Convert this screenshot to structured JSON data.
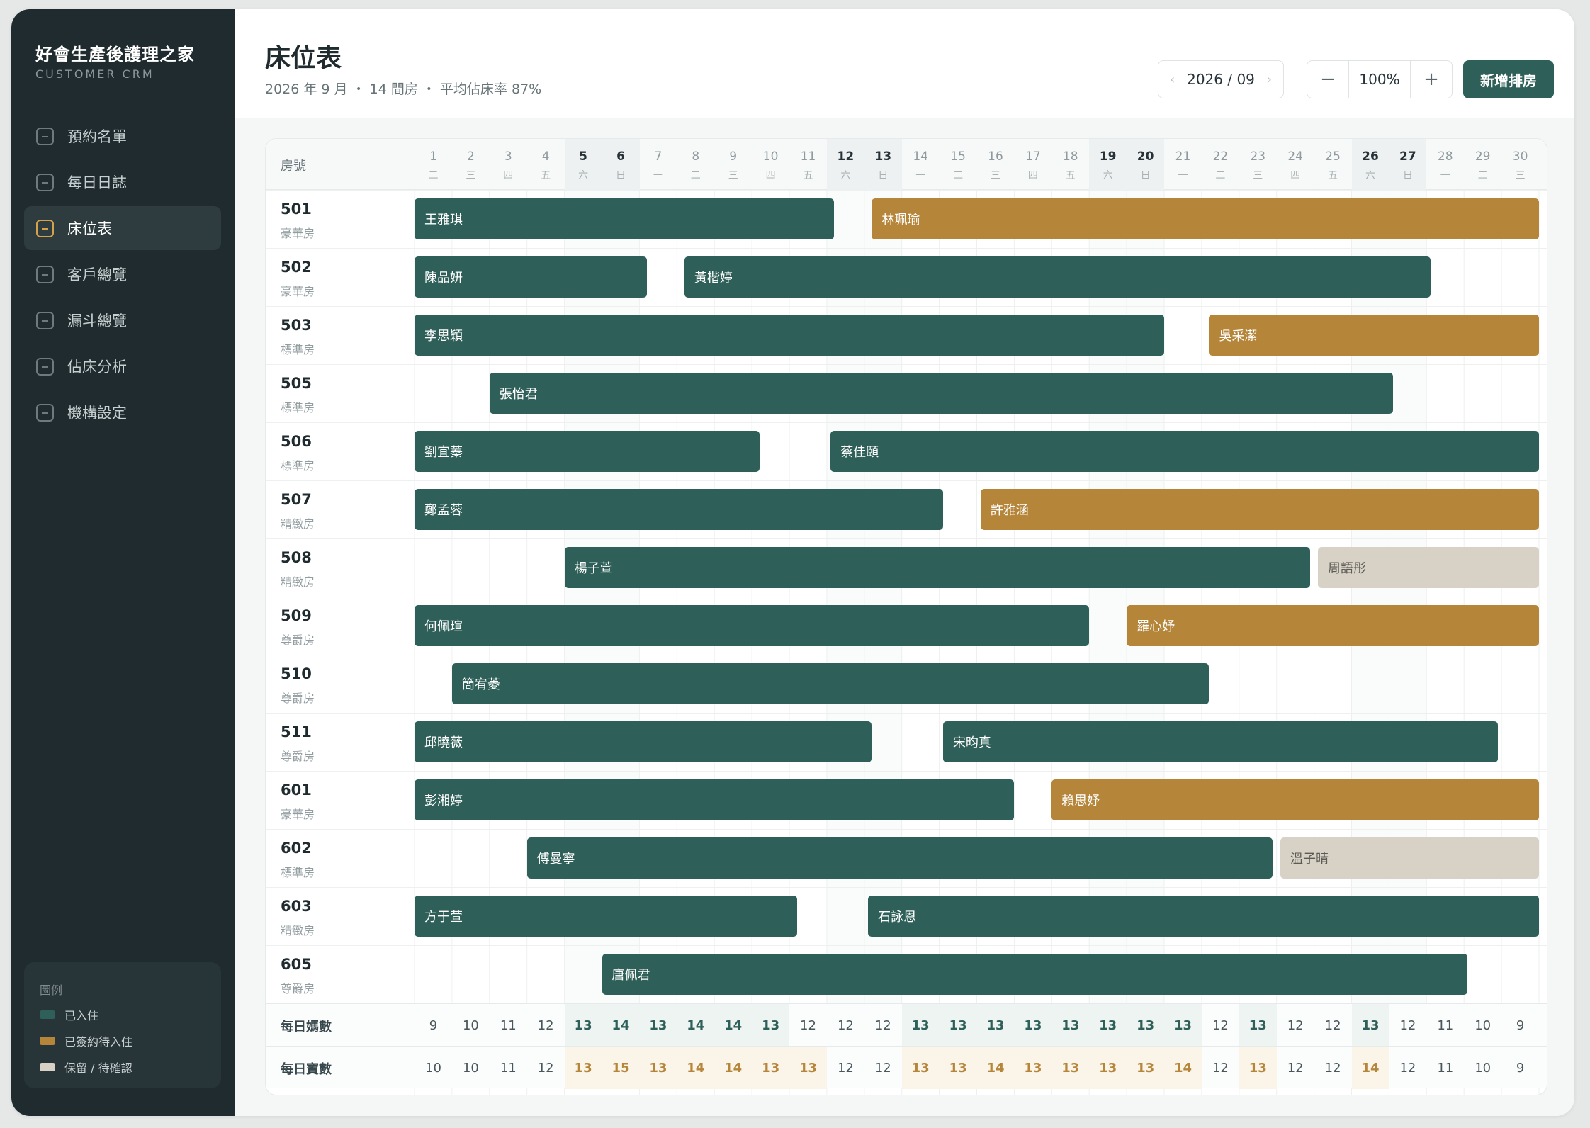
{
  "sidebar": {
    "brand": "好會生產後護理之家",
    "brand_sub": "CUSTOMER CRM",
    "nav": [
      "預約名單",
      "每日日誌",
      "床位表",
      "客戶總覽",
      "漏斗總覽",
      "佔床分析",
      "機構設定"
    ],
    "active_index": 2,
    "legend": {
      "title": "圖例",
      "items": [
        {
          "label": "已入住",
          "color": "#2e5f58"
        },
        {
          "label": "已簽約待入住",
          "color": "#b5853a"
        },
        {
          "label": "保留 / 待確認",
          "color": "#d8d2c6"
        }
      ]
    }
  },
  "header": {
    "title": "床位表",
    "subtitle": "2026 年 9 月 ・ 14 間房 ・ 平均佔床率 87%",
    "month": "2026 / 09",
    "zoom": "100%",
    "add_button": "新增排房",
    "prev_icon": "chevron-left-icon",
    "next_icon": "chevron-right-icon"
  },
  "grid": {
    "room_col_label": "房號",
    "days": [
      {
        "d": "1",
        "w": "二"
      },
      {
        "d": "2",
        "w": "三"
      },
      {
        "d": "3",
        "w": "四"
      },
      {
        "d": "4",
        "w": "五"
      },
      {
        "d": "5",
        "w": "六",
        "we": true
      },
      {
        "d": "6",
        "w": "日",
        "we": true
      },
      {
        "d": "7",
        "w": "一"
      },
      {
        "d": "8",
        "w": "二"
      },
      {
        "d": "9",
        "w": "三"
      },
      {
        "d": "10",
        "w": "四"
      },
      {
        "d": "11",
        "w": "五"
      },
      {
        "d": "12",
        "w": "六",
        "we": true
      },
      {
        "d": "13",
        "w": "日",
        "we": true
      },
      {
        "d": "14",
        "w": "一"
      },
      {
        "d": "15",
        "w": "二"
      },
      {
        "d": "16",
        "w": "三"
      },
      {
        "d": "17",
        "w": "四"
      },
      {
        "d": "18",
        "w": "五"
      },
      {
        "d": "19",
        "w": "六",
        "we": true
      },
      {
        "d": "20",
        "w": "日",
        "we": true
      },
      {
        "d": "21",
        "w": "一"
      },
      {
        "d": "22",
        "w": "二"
      },
      {
        "d": "23",
        "w": "三"
      },
      {
        "d": "24",
        "w": "四"
      },
      {
        "d": "25",
        "w": "五"
      },
      {
        "d": "26",
        "w": "六",
        "we": true
      },
      {
        "d": "27",
        "w": "日",
        "we": true
      },
      {
        "d": "28",
        "w": "一"
      },
      {
        "d": "29",
        "w": "二"
      },
      {
        "d": "30",
        "w": "三"
      }
    ],
    "rooms": [
      {
        "no": "501",
        "type": "豪華房",
        "stays": [
          {
            "name": "王雅琪",
            "start": 1,
            "end": 11.2,
            "status": "in"
          },
          {
            "name": "林珮瑜",
            "start": 13.2,
            "end": 30,
            "status": "pending"
          }
        ]
      },
      {
        "no": "502",
        "type": "豪華房",
        "stays": [
          {
            "name": "陳品妍",
            "start": 1,
            "end": 6.2,
            "status": "in"
          },
          {
            "name": "黃楷婷",
            "start": 8.2,
            "end": 27.1,
            "status": "in"
          }
        ]
      },
      {
        "no": "503",
        "type": "標準房",
        "stays": [
          {
            "name": "李思穎",
            "start": 1,
            "end": 20,
            "status": "in"
          },
          {
            "name": "吳采潔",
            "start": 22.2,
            "end": 30,
            "status": "pending"
          }
        ]
      },
      {
        "no": "505",
        "type": "標準房",
        "stays": [
          {
            "name": "張怡君",
            "start": 3,
            "end": 26.1,
            "status": "in"
          }
        ]
      },
      {
        "no": "506",
        "type": "標準房",
        "stays": [
          {
            "name": "劉宜蓁",
            "start": 1,
            "end": 9.2,
            "status": "in"
          },
          {
            "name": "蔡佳頤",
            "start": 12.1,
            "end": 30,
            "status": "in"
          }
        ]
      },
      {
        "no": "507",
        "type": "精緻房",
        "stays": [
          {
            "name": "鄭孟蓉",
            "start": 1,
            "end": 14.1,
            "status": "in"
          },
          {
            "name": "許雅涵",
            "start": 16.1,
            "end": 30,
            "status": "pending"
          }
        ]
      },
      {
        "no": "508",
        "type": "精緻房",
        "stays": [
          {
            "name": "楊子萱",
            "start": 5,
            "end": 23.9,
            "status": "in"
          },
          {
            "name": "周語彤",
            "start": 25.1,
            "end": 30,
            "status": "hold"
          }
        ]
      },
      {
        "no": "509",
        "type": "尊爵房",
        "stays": [
          {
            "name": "何佩瑄",
            "start": 1,
            "end": 18,
            "status": "in"
          },
          {
            "name": "羅心妤",
            "start": 20,
            "end": 30,
            "status": "pending"
          }
        ]
      },
      {
        "no": "510",
        "type": "尊爵房",
        "stays": [
          {
            "name": "簡宥菱",
            "start": 2,
            "end": 21.2,
            "status": "in"
          }
        ]
      },
      {
        "no": "511",
        "type": "尊爵房",
        "stays": [
          {
            "name": "邱曉薇",
            "start": 1,
            "end": 12.2,
            "status": "in"
          },
          {
            "name": "宋昀真",
            "start": 15.1,
            "end": 28.9,
            "status": "in"
          }
        ]
      },
      {
        "no": "601",
        "type": "豪華房",
        "stays": [
          {
            "name": "彭湘婷",
            "start": 1,
            "end": 16,
            "status": "in"
          },
          {
            "name": "賴思妤",
            "start": 18,
            "end": 30,
            "status": "pending"
          }
        ]
      },
      {
        "no": "602",
        "type": "標準房",
        "stays": [
          {
            "name": "傅曼寧",
            "start": 4,
            "end": 22.9,
            "status": "in"
          },
          {
            "name": "溫子晴",
            "start": 24.1,
            "end": 30,
            "status": "hold"
          }
        ]
      },
      {
        "no": "603",
        "type": "精緻房",
        "stays": [
          {
            "name": "方于萱",
            "start": 1,
            "end": 10.2,
            "status": "in"
          },
          {
            "name": "石詠恩",
            "start": 13.1,
            "end": 30,
            "status": "in"
          }
        ]
      },
      {
        "no": "605",
        "type": "尊爵房",
        "stays": [
          {
            "name": "唐佩君",
            "start": 6,
            "end": 28.1,
            "status": "in"
          }
        ]
      }
    ],
    "summary": [
      {
        "label": "每日媽數",
        "values": [
          9,
          10,
          11,
          12,
          13,
          14,
          13,
          14,
          14,
          13,
          12,
          12,
          12,
          13,
          13,
          13,
          13,
          13,
          13,
          13,
          13,
          12,
          13,
          12,
          12,
          13,
          12,
          11,
          10,
          9
        ]
      },
      {
        "label": "每日寶數",
        "values": [
          10,
          10,
          11,
          12,
          13,
          15,
          13,
          14,
          14,
          13,
          13,
          12,
          12,
          13,
          13,
          14,
          13,
          13,
          13,
          13,
          14,
          12,
          13,
          12,
          12,
          14,
          12,
          11,
          10,
          9
        ]
      }
    ]
  }
}
